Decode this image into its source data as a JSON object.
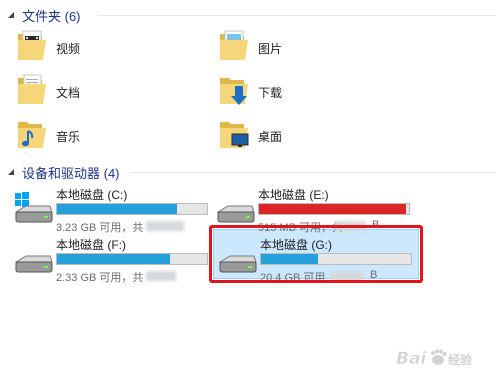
{
  "folders_group": {
    "title": "文件夹 (6)",
    "items": [
      {
        "label": "视频",
        "icon": "video-folder-icon"
      },
      {
        "label": "图片",
        "icon": "pictures-folder-icon"
      },
      {
        "label": "文档",
        "icon": "documents-folder-icon"
      },
      {
        "label": "下载",
        "icon": "downloads-folder-icon"
      },
      {
        "label": "音乐",
        "icon": "music-folder-icon"
      },
      {
        "label": "桌面",
        "icon": "desktop-folder-icon"
      }
    ]
  },
  "drives_group": {
    "title": "设备和驱动器 (4)",
    "items": [
      {
        "label": "本地磁盘 (C:)",
        "free": "3.23 GB 可用，共",
        "used_fraction": 0.8,
        "color": "#26a0da",
        "system": true
      },
      {
        "label": "本地磁盘 (E:)",
        "free": "515 MB 可用，共",
        "suffix": "B",
        "used_fraction": 0.98,
        "color": "#da2626"
      },
      {
        "label": "本地磁盘 (F:)",
        "free": "2.33 GB 可用，共",
        "used_fraction": 0.75,
        "color": "#26a0da"
      },
      {
        "label": "本地磁盘 (G:)",
        "free": "20.4 GB 可用",
        "suffix": "B",
        "used_fraction": 0.38,
        "color": "#26a0da",
        "selected": true
      }
    ]
  },
  "watermark": {
    "text": "Baidu 经验"
  },
  "colors": {
    "header": "#1e3287",
    "bar_normal": "#26a0da",
    "bar_critical": "#da2626",
    "highlight": "#e3131a"
  }
}
